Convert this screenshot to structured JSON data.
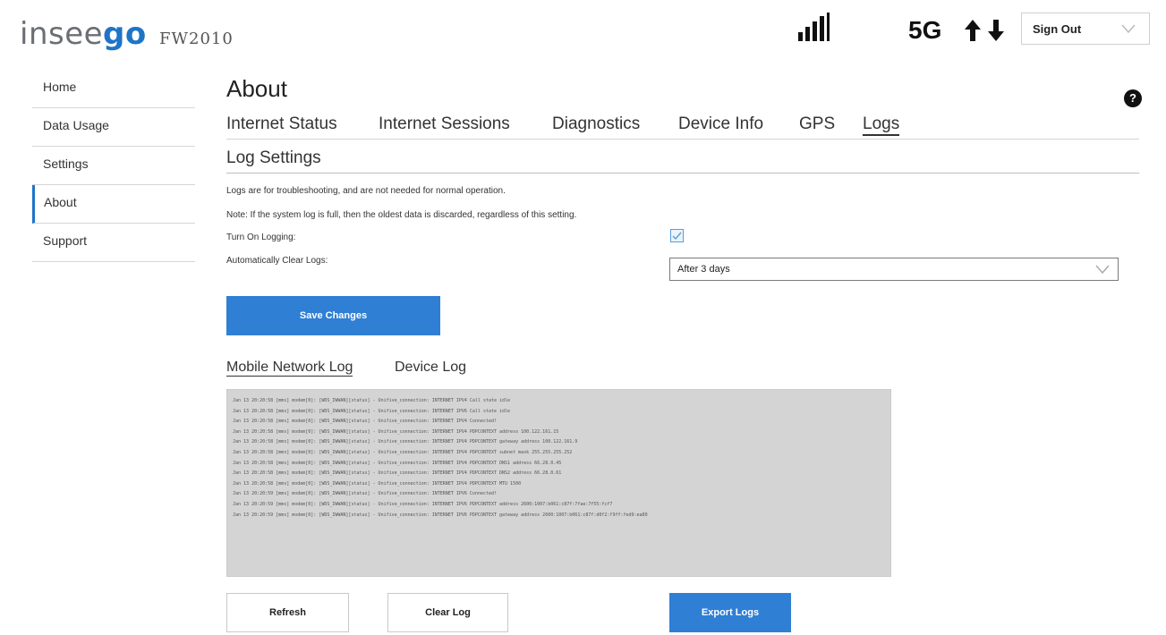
{
  "header": {
    "logo_text_a": "insee",
    "logo_text_b": "go",
    "model": "FW2010",
    "network_tech": "5G",
    "signal_icon": "signal-bars-icon",
    "transfer_icon": "up-down-arrows-icon",
    "account_menu_label": "Sign Out",
    "colors": {
      "brand": "#1f74c6",
      "logo_gray": "#6b6f74"
    }
  },
  "sidebar": {
    "items": [
      {
        "label": "Home",
        "active": false
      },
      {
        "label": "Data Usage",
        "active": false
      },
      {
        "label": "Settings",
        "active": false
      },
      {
        "label": "About",
        "active": true
      },
      {
        "label": "Support",
        "active": false
      }
    ]
  },
  "main": {
    "title": "About",
    "help_icon": "question-circle-icon",
    "tabs": [
      {
        "label": "Internet Status",
        "active": false
      },
      {
        "label": "Internet Sessions",
        "active": false
      },
      {
        "label": "Diagnostics",
        "active": false
      },
      {
        "label": "Device Info",
        "active": false
      },
      {
        "label": "GPS",
        "active": false
      },
      {
        "label": "Logs",
        "active": true
      }
    ],
    "section_title": "Log Settings",
    "note_1": "Logs are for troubleshooting, and are not needed for normal operation.",
    "note_2": "Note: If the system log is full, then the oldest data is discarded, regardless of this setting.",
    "logging_label": "Turn On Logging:",
    "logging_enabled": true,
    "auto_clear_label": "Automatically Clear Logs:",
    "auto_clear_value": "After 3 days",
    "save_button": "Save Changes",
    "log_tabs": [
      {
        "label": "Mobile Network Log",
        "active": true
      },
      {
        "label": "Device Log",
        "active": false
      }
    ],
    "log_lines": [
      "Jan 13 20:20:58 [mms] modem[0]: [WDS_IWWAN][status] - Unifive_connection: INTERNET IPV4 Call state idle",
      "Jan 13 20:20:58 [mms] modem[0]: [WDS_IWWAN][status] - Unifive_connection: INTERNET IPV6 Call state idle",
      "Jan 13 20:20:58 [mms] modem[0]: [WDS_IWWAN][status] - Unifive_connection: INTERNET IPV4 Connected!",
      "Jan 13 20:20:58 [mms] modem[0]: [WDS_IWWAN][status] - Unifive_connection: INTERNET IPV4 PDPCONTEXT address 100.122.161.15",
      "Jan 13 20:20:58 [mms] modem[0]: [WDS_IWWAN][status] - Unifive_connection: INTERNET IPV4 PDPCONTEXT gateway address 100.122.161.9",
      "Jan 13 20:20:58 [mms] modem[0]: [WDS_IWWAN][status] - Unifive_connection: INTERNET IPV4 PDPCONTEXT subnet mask 255.255.255.252",
      "Jan 13 20:20:58 [mms] modem[0]: [WDS_IWWAN][status] - Unifive_connection: INTERNET IPV4 PDPCONTEXT DNS1 address 66.28.0.45",
      "Jan 13 20:20:58 [mms] modem[0]: [WDS_IWWAN][status] - Unifive_connection: INTERNET IPV4 PDPCONTEXT DNS2 address 66.28.0.61",
      "Jan 13 20:20:58 [mms] modem[0]: [WDS_IWWAN][status] - Unifive_connection: INTERNET IPV4 PDPCONTEXT MTU 1500",
      "Jan 13 20:20:59 [mms] modem[0]: [WDS_IWWAN][status] - Unifive_connection: INTERNET IPV6 Connected!",
      "Jan 13 20:20:59 [mms] modem[0]: [WDS_IWWAN][status] - Unifive_connection: INTERNET IPV6 PDPCONTEXT address 2600:1007:b061:c87f:7fae:7f55:fcf7",
      "Jan 13 20:20:59 [mms] modem[0]: [WDS_IWWAN][status] - Unifive_connection: INTERNET IPV6 PDPCONTEXT gateway address 2600:1007:b061:c87f:d0f2:f9ff:fed9:ea80"
    ],
    "refresh_button": "Refresh",
    "clear_button": "Clear Log",
    "export_button": "Export Logs"
  }
}
